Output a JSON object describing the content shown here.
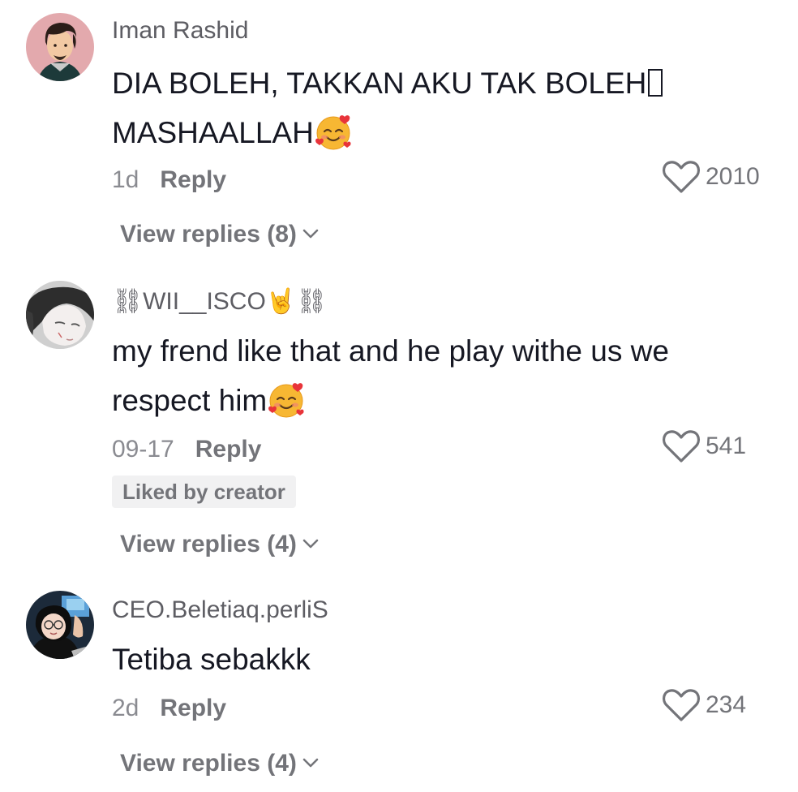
{
  "comments": [
    {
      "username": "Iman Rashid",
      "lines": [
        "DIA BOLEH, TAKKAN AKU TAK BOLEH",
        "MASHAALLAH"
      ],
      "time": "1d",
      "reply_label": "Reply",
      "likes": "2010",
      "view_replies": "View replies (8)",
      "avatar_icon": "cartoon-man-avatar",
      "emoji": "smiling-face-with-hearts"
    },
    {
      "username_prefix": "⛓",
      "username": "WII__ISCO",
      "username_suffix": "🤘⛓",
      "lines": [
        "my frend like that and he play withe us we",
        "respect him"
      ],
      "time": "09-17",
      "reply_label": "Reply",
      "likes": "541",
      "badge": "Liked by creator",
      "view_replies": "View replies (4)",
      "avatar_icon": "anime-girl-avatar",
      "emoji": "smiling-face-with-hearts"
    },
    {
      "username": "CEO.Beletiaq.perliS",
      "lines": [
        "Tetiba sebakkk"
      ],
      "time": "2d",
      "reply_label": "Reply",
      "likes": "234",
      "view_replies": "View replies (4)",
      "avatar_icon": "girl-with-glasses-avatar"
    }
  ],
  "colors": {
    "text": "#161823",
    "secondary": "#737479",
    "badge_bg": "#f1f1f2"
  }
}
